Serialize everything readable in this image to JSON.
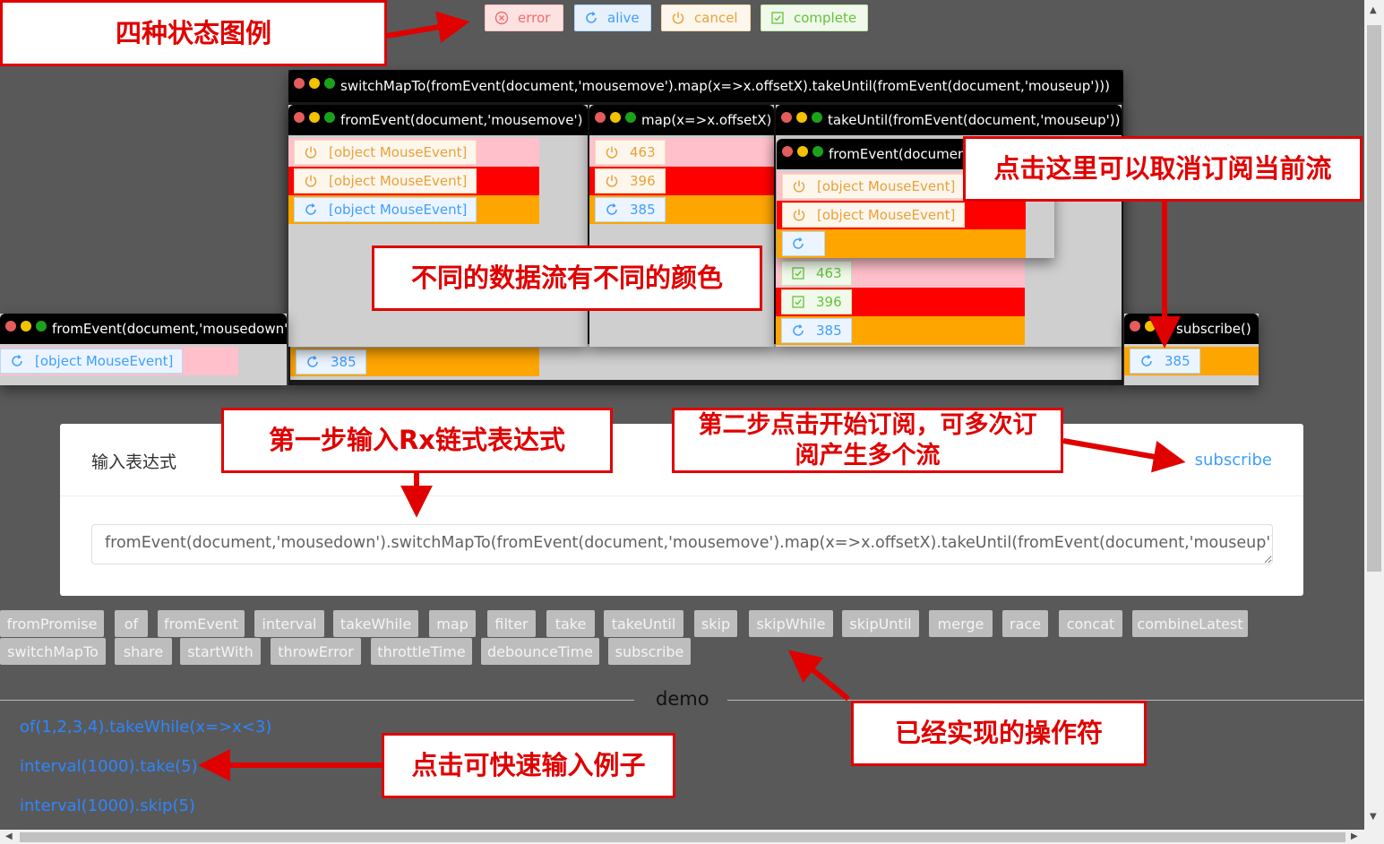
{
  "legend": {
    "error": "error",
    "alive": "alive",
    "cancel": "cancel",
    "complete": "complete"
  },
  "streams": {
    "mousedown": {
      "title": "fromEvent(document,'mousedown')",
      "rows": [
        {
          "status": "alive",
          "value": "[object MouseEvent]",
          "color": "pink"
        }
      ]
    },
    "switchmap": {
      "title": "switchMapTo(fromEvent(document,'mousemove').map(x=>x.offsetX).takeUntil(fromEvent(document,'mouseup')))",
      "rows": [
        {
          "status": "alive",
          "value": "385",
          "color": "orange"
        }
      ]
    },
    "mousemove": {
      "title": "fromEvent(document,'mousemove')",
      "rows": [
        {
          "status": "cancel",
          "value": "[object MouseEvent]",
          "color": "pink"
        },
        {
          "status": "cancel",
          "value": "[object MouseEvent]",
          "color": "red"
        },
        {
          "status": "alive",
          "value": "[object MouseEvent]",
          "color": "orange"
        }
      ]
    },
    "map": {
      "title": "map(x=>x.offsetX)",
      "rows": [
        {
          "status": "cancel",
          "value": "463",
          "color": "pink"
        },
        {
          "status": "cancel",
          "value": "396",
          "color": "red"
        },
        {
          "status": "alive",
          "value": "385",
          "color": "orange"
        }
      ]
    },
    "takeuntil": {
      "title": "takeUntil(fromEvent(document,'mouseup'))",
      "rows": [
        {
          "status": "complete",
          "value": "463",
          "color": "pink"
        },
        {
          "status": "complete",
          "value": "396",
          "color": "red"
        },
        {
          "status": "alive",
          "value": "385",
          "color": "orange"
        }
      ]
    },
    "mouseup": {
      "title": "fromEvent(document,'mouseup')",
      "rows": [
        {
          "status": "cancel",
          "value": "[object MouseEvent]",
          "color": "pink"
        },
        {
          "status": "cancel",
          "value": "[object MouseEvent]",
          "color": "red"
        },
        {
          "status": "alive",
          "value": "",
          "color": "orange"
        }
      ]
    },
    "subscribe": {
      "title": "subscribe()",
      "rows": [
        {
          "status": "alive",
          "value": "385",
          "color": "orange"
        }
      ]
    }
  },
  "annotations": {
    "legend": "四种状态图例",
    "unsubscribe": "点击这里可以取消订阅当前流",
    "colors": "不同的数据流有不同的颜色",
    "step1": "第一步输入Rx链式表达式",
    "step2": "第二步点击开始订阅，可多次订阅产生多个流",
    "operators": "已经实现的操作符",
    "examples": "点击可快速输入例子"
  },
  "input_card": {
    "title": "输入表达式",
    "subscribe": "subscribe",
    "expression": "fromEvent(document,'mousedown').switchMapTo(fromEvent(document,'mousemove').map(x=>x.offsetX).takeUntil(fromEvent(document,'mouseup')))"
  },
  "operators": [
    "fromPromise",
    "of",
    "fromEvent",
    "interval",
    "takeWhile",
    "map",
    "filter",
    "take",
    "takeUntil",
    "skip",
    "skipWhile",
    "skipUntil",
    "merge",
    "race",
    "concat",
    "combineLatest",
    "switchMapTo",
    "share",
    "startWith",
    "throwError",
    "throttleTime",
    "debounceTime",
    "subscribe"
  ],
  "demo": {
    "title": "demo",
    "examples": [
      "of(1,2,3,4).takeWhile(x=>x<3)",
      "interval(1000).take(5)",
      "interval(1000).skip(5)"
    ]
  },
  "colors": {
    "error": "#f56c6c",
    "alive": "#409eff",
    "cancel": "#e6a23c",
    "complete": "#67c23a",
    "pink": "#ffc0cb",
    "red": "#ff0000",
    "orange": "#ffa500",
    "annotation": "#e00000"
  }
}
